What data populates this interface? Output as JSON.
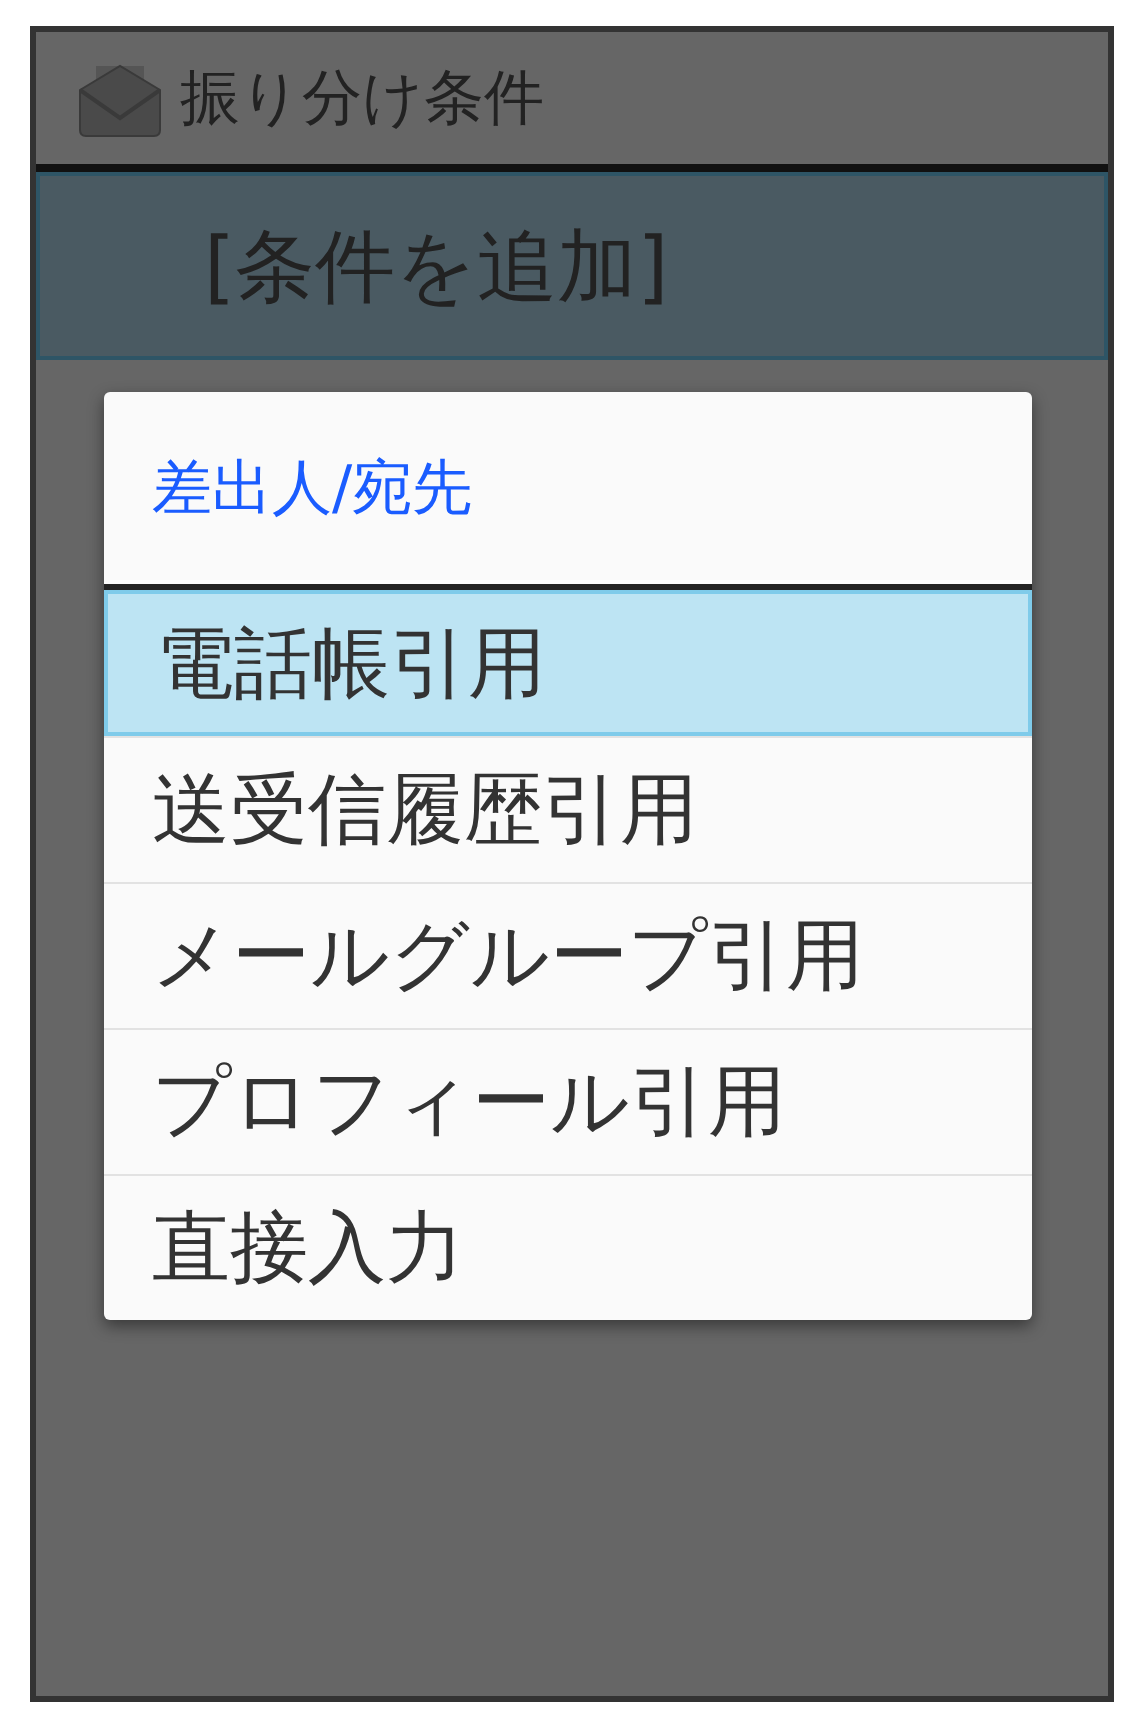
{
  "window": {
    "title": "振り分け条件"
  },
  "list": {
    "items": [
      {
        "label": "[条件を追加]",
        "selected": true
      }
    ]
  },
  "dialog": {
    "title": "差出人/宛先",
    "items": [
      {
        "label": "電話帳引用",
        "selected": true
      },
      {
        "label": "送受信履歴引用",
        "selected": false
      },
      {
        "label": "メールグループ引用",
        "selected": false
      },
      {
        "label": "プロフィール引用",
        "selected": false
      },
      {
        "label": "直接入力",
        "selected": false
      }
    ]
  }
}
